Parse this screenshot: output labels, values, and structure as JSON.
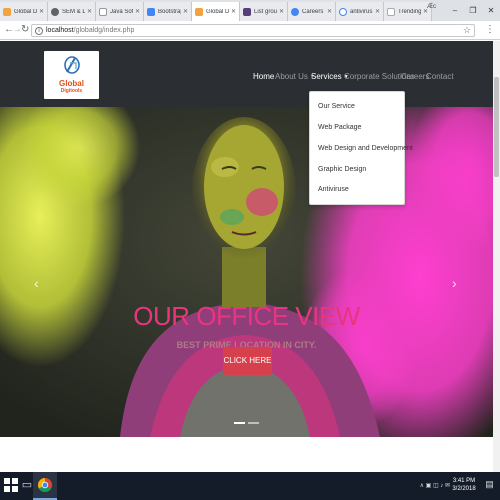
{
  "browser": {
    "tabs": [
      {
        "title": "Global Digi",
        "color": "#f1a340"
      },
      {
        "title": "SEM & Log",
        "color": "#5f6368"
      },
      {
        "title": "Java Softw",
        "color": "#ffffff"
      },
      {
        "title": "Bootstrap",
        "color": "#4285f4"
      },
      {
        "title": "Global Dig",
        "color": "#f1a340"
      },
      {
        "title": "List group",
        "color": "#563d7c"
      },
      {
        "title": "Careers – G",
        "color": "#4285f4"
      },
      {
        "title": "antivirus -",
        "color": "#ffffff"
      },
      {
        "title": "Trending Fi",
        "color": "#ffffff"
      }
    ],
    "profile_label": "Æc",
    "url_host": "localhost",
    "url_path": "/globaldg/index.php"
  },
  "site": {
    "logo": {
      "line1": "Global",
      "line2": "Digitools"
    },
    "nav": [
      {
        "label": "Home",
        "state": "active",
        "caret": false
      },
      {
        "label": "About Us",
        "state": "normal",
        "caret": true
      },
      {
        "label": "Services",
        "state": "open",
        "caret": true
      },
      {
        "label": "Corporate Solutions",
        "state": "normal",
        "caret": false
      },
      {
        "label": "Careers",
        "state": "normal",
        "caret": false
      },
      {
        "label": "Contact",
        "state": "normal",
        "caret": false
      }
    ],
    "services_menu": [
      "Our Service",
      "Web Package",
      "Web Design and Development",
      "Graphic Design",
      "Antiviruse"
    ],
    "hero": {
      "title": "OUR OFFICE VIEW",
      "subtitle": "BEST PRIME LOCATION IN CITY.",
      "button": "CLICK HERE"
    }
  },
  "taskbar": {
    "time": "3:41 PM",
    "date": "3/2/2018"
  },
  "colors": {
    "navbar": "#2b2f33",
    "accent_pink": "#e9357f",
    "button_red": "#d5404c",
    "brand_orange": "#e0501c"
  }
}
